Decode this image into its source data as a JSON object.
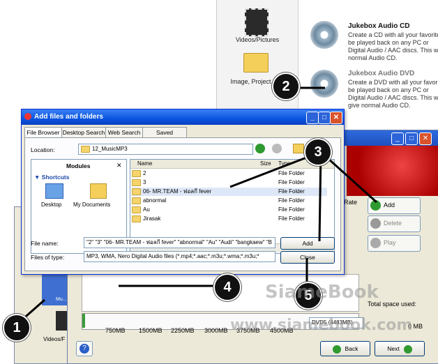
{
  "top_window": {
    "items": [
      {
        "label": "Videos/Pictures"
      },
      {
        "label": "Image, Project, C..."
      }
    ],
    "options": [
      {
        "title": "Jukebox Audio CD",
        "desc": "Create a CD with all your favorite be played back on any PC or Digital Audio / AAC discs. This w a normal Audio CD."
      },
      {
        "title": "Jukebox Audio DVD",
        "desc": "Create a DVD with all your favorite be played back on any PC or Digital Audio / AAC discs. This will give normal Audio CD."
      }
    ]
  },
  "dialog": {
    "title": "Add files and folders",
    "tabs": [
      "File Browser",
      "Desktop Search",
      "Web Search",
      "Saved Searches"
    ],
    "location_label": "Location:",
    "location_value": "12_MusicMP3",
    "modules_title": "Modules",
    "shortcuts_label": "Shortcuts",
    "shortcut_items": [
      "Desktop",
      "My Documents"
    ],
    "columns": {
      "name": "Name",
      "size": "Size",
      "type": "Type"
    },
    "rows": [
      {
        "name": "2",
        "type": "File Folder"
      },
      {
        "name": "3",
        "type": "File Folder"
      },
      {
        "name": "06- MR.TEAM - ฟอลกี fever",
        "type": "File Folder"
      },
      {
        "name": "abnormal",
        "type": "File Folder"
      },
      {
        "name": "Au",
        "type": "File Folder"
      },
      {
        "name": "Jirasak",
        "type": "File Folder"
      }
    ],
    "file_name_label": "File name:",
    "file_name_value": "\"2\" \"3\" \"06- MR.TEAM - ฟอลกี fever\" \"abnormal\" \"Au\" \"Audi\" \"bangkaew\" \"B",
    "file_type_label": "Files of type:",
    "file_type_value": "MP3, WMA, Nero Digital Audio files (*.mp4;*.aac;*.m3u;*.wma;*.m3u;*",
    "add_label": "Add",
    "close_label": "Close"
  },
  "main_window": {
    "rate_label": "Rate",
    "buttons": {
      "add": "Add",
      "delete": "Delete",
      "play": "Play"
    },
    "scale_labels": [
      "750MB",
      "1500MB",
      "2250MB",
      "3000MB",
      "3750MB",
      "4500MB"
    ],
    "disc_select": "DVD5 (4483MB)",
    "total_space_label": "Total space used:",
    "total_space_value": "0 MB",
    "back_label": "Back",
    "next_label": "Next",
    "left_icon_label": "Mu...",
    "left_icon2_label": "Videos/F"
  },
  "callouts": [
    "1",
    "2",
    "3",
    "4",
    "5"
  ],
  "watermark": {
    "line1": "SiameBook",
    "line2": "www.siamebook.com"
  },
  "colors": {
    "title_blue": "#0a55e0",
    "callout_bg": "#111111",
    "add_icon_green": "#2f9a2f",
    "close_red": "#d9532c"
  }
}
